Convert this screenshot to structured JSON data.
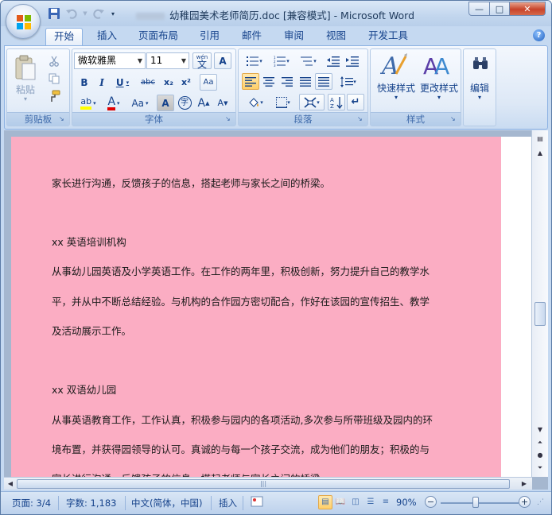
{
  "window": {
    "title_prefix_hidden": "",
    "title": "幼稚园美术老师简历.doc [兼容模式] - Microsoft Word",
    "controls": {
      "minimize": "—",
      "maximize": "□",
      "close": "✕"
    }
  },
  "tabs": [
    "开始",
    "插入",
    "页面布局",
    "引用",
    "邮件",
    "审阅",
    "视图",
    "开发工具"
  ],
  "active_tab": "开始",
  "ribbon": {
    "clipboard": {
      "label": "剪贴板",
      "paste": "粘贴"
    },
    "font": {
      "label": "字体",
      "font_name": "微软雅黑",
      "font_size": "11",
      "wen": "wén",
      "wen_char": "文",
      "A_box": "A",
      "bold": "B",
      "italic": "I",
      "underline": "U",
      "strike": "abc",
      "subscript": "x₂",
      "superscript": "x²",
      "clear": "Aa",
      "char_shading": "A",
      "enclose": "字",
      "grow": "A",
      "shrink": "A"
    },
    "paragraph": {
      "label": "段落"
    },
    "styles": {
      "label": "样式",
      "quick": "快速样式",
      "change": "更改样式"
    },
    "edit": {
      "label": "编辑"
    }
  },
  "document": {
    "lines": [
      "家长进行沟通，反馈孩子的信息，搭起老师与家长之间的桥梁。",
      "xx 英语培训机构",
      "从事幼儿园英语及小学英语工作。在工作的两年里，积极创新，努力提升自己的教学水",
      "平，并从中不断总结经验。与机构的合作园方密切配合，作好在该园的宣传招生、教学",
      "及活动展示工作。",
      "xx 双语幼儿园",
      "从事英语教育工作，工作认真，积极参与园内的各项活动,多次参与所带班级及园内的环",
      "境布置，并获得园领导的认可。真诚的与每一个孩子交流，成为他们的朋友；积极的与",
      "家长进行沟通，反馈孩子的信息，搭起老师与家长之间的桥梁。"
    ],
    "page_color": "#fbadc3"
  },
  "statusbar": {
    "page": "页面: 3/4",
    "words": "字数: 1,183",
    "language": "中文(简体，中国)",
    "mode": "插入",
    "zoom": "90%",
    "zoom_level": 0.9
  }
}
